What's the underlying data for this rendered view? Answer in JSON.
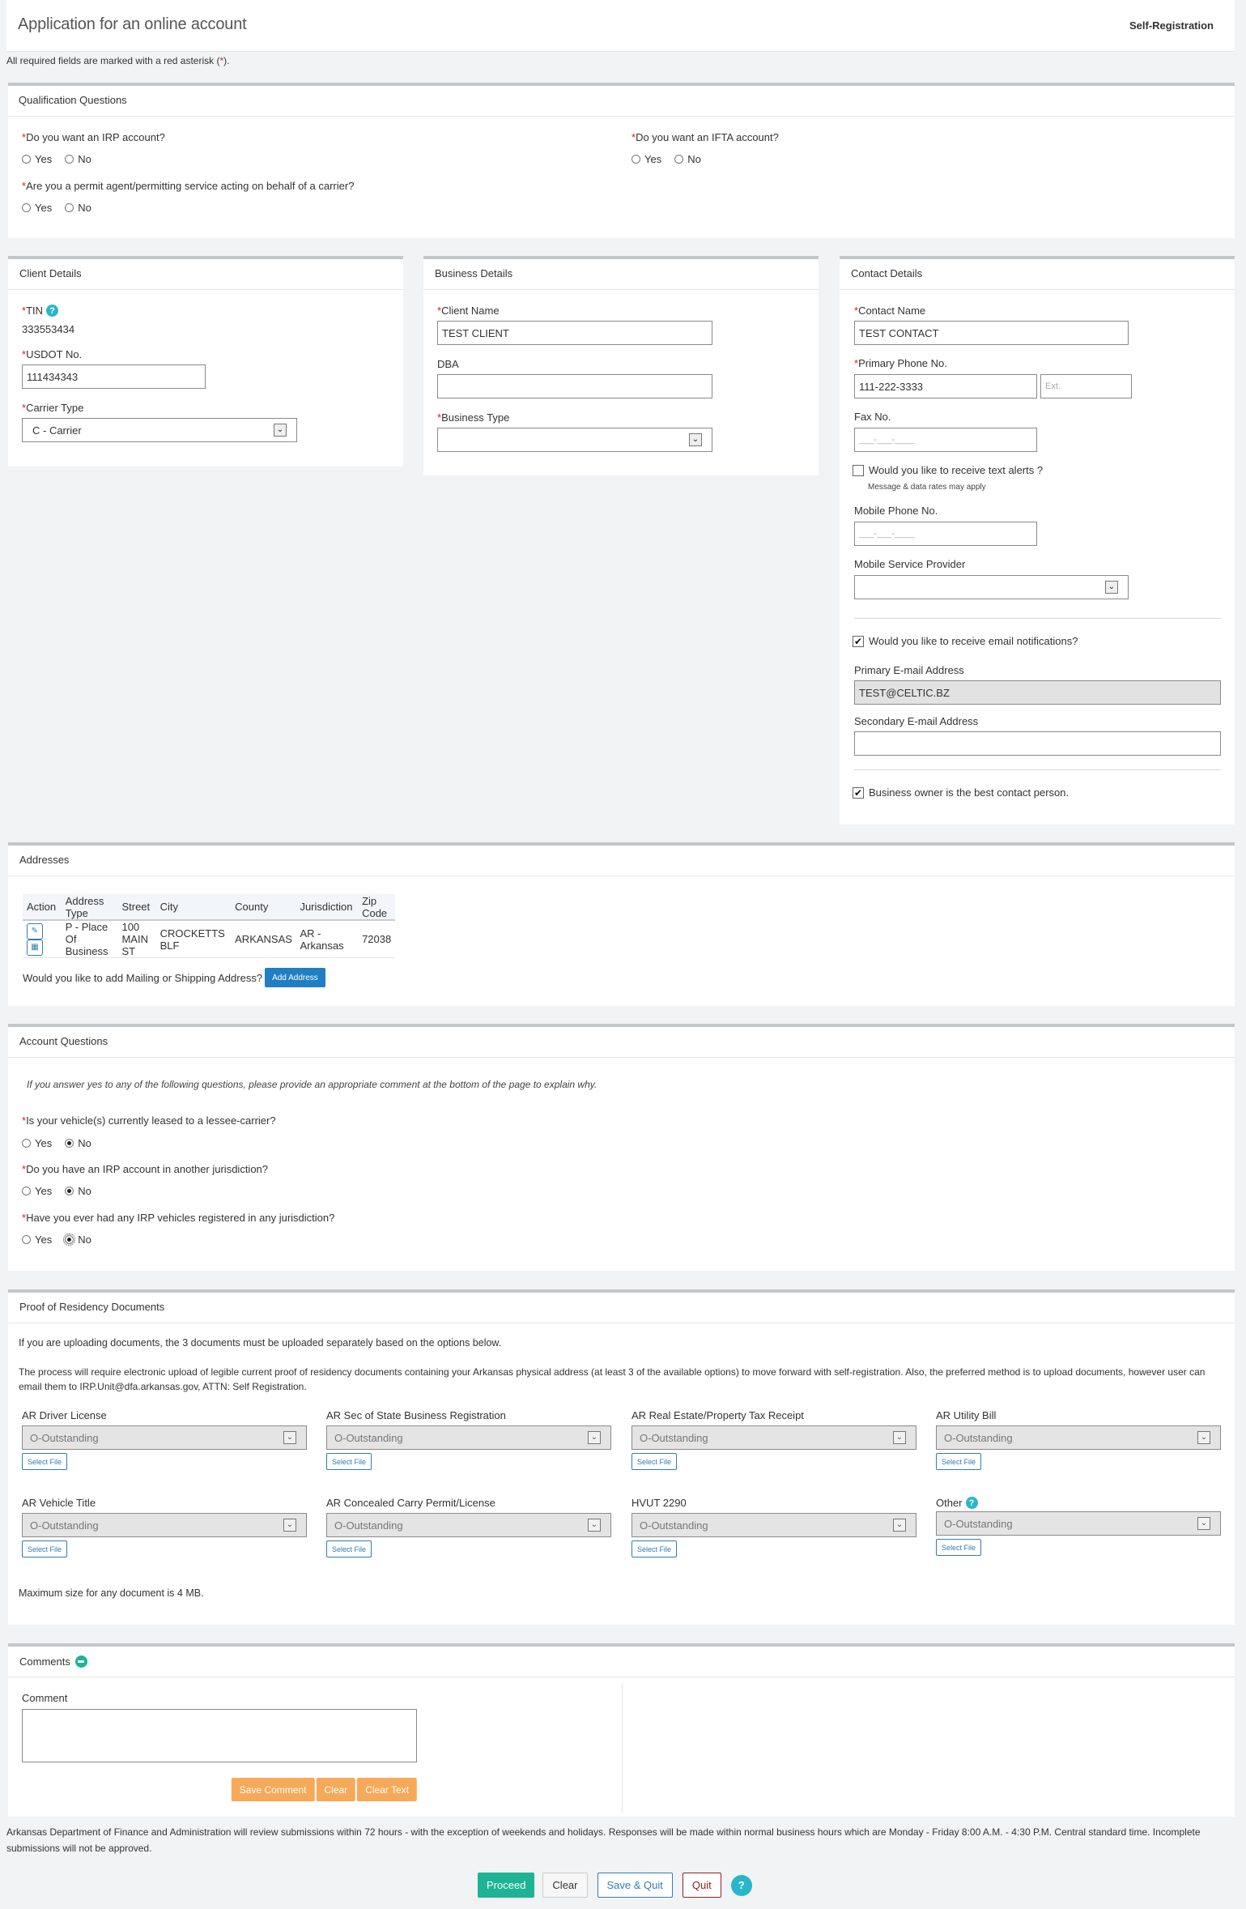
{
  "header": {
    "title": "Application for an online account",
    "context": "Self-Registration",
    "required_note_prefix": "All required fields are marked with a red asterisk (",
    "required_note_star": "*",
    "required_note_suffix": ")."
  },
  "qualification": {
    "title": "Qualification Questions",
    "questions": [
      {
        "label": "Do you want an IRP account?",
        "yes": "Yes",
        "no": "No",
        "selected": null
      },
      {
        "label": "Do you want an IFTA account?",
        "yes": "Yes",
        "no": "No",
        "selected": null
      },
      {
        "label": "Are you a permit agent/permitting service acting on behalf of a carrier?",
        "yes": "Yes",
        "no": "No",
        "selected": null
      }
    ]
  },
  "client": {
    "title": "Client Details",
    "tin_label": "TIN",
    "tin_value": "333553434",
    "usdot_label": "USDOT No.",
    "usdot_value": "111434343",
    "carrier_type_label": "Carrier Type",
    "carrier_type_value": "C - Carrier"
  },
  "business": {
    "title": "Business Details",
    "client_name_label": "Client Name",
    "client_name_value": "TEST CLIENT",
    "dba_label": "DBA",
    "dba_value": "",
    "business_type_label": "Business Type",
    "business_type_value": ""
  },
  "contact": {
    "title": "Contact Details",
    "contact_name_label": "Contact Name",
    "contact_name_value": "TEST CONTACT",
    "primary_phone_label": "Primary Phone No.",
    "primary_phone_value": "111-222-3333",
    "ext_placeholder": "Ext.",
    "fax_label": "Fax No.",
    "fax_mask": "___-___-____",
    "text_alerts_label": "Would you like to receive text alerts ?",
    "text_alerts_checked": false,
    "text_alerts_note": "Message & data rates may apply",
    "mobile_label": "Mobile Phone No.",
    "mobile_mask": "___-___-____",
    "provider_label": "Mobile Service Provider",
    "provider_value": "",
    "email_notif_label": "Would you like to receive email notifications?",
    "email_notif_checked": true,
    "primary_email_label": "Primary E-mail Address",
    "primary_email_value": "TEST@CELTIC.BZ",
    "secondary_email_label": "Secondary E-mail Address",
    "secondary_email_value": "",
    "owner_contact_label": "Business owner is the best contact person.",
    "owner_contact_checked": true
  },
  "addresses": {
    "title": "Addresses",
    "columns": [
      "Action",
      "Address Type",
      "Street",
      "City",
      "County",
      "Jurisdiction",
      "Zip Code"
    ],
    "rows": [
      {
        "type": "P - Place Of Business",
        "street": "100 MAIN ST",
        "city": "CROCKETTS BLF",
        "county": "ARKANSAS",
        "jurisdiction": "AR - Arkansas",
        "zip": "72038"
      }
    ],
    "add_prompt": "Would you like to add Mailing or Shipping Address?",
    "add_button": "Add Address"
  },
  "account_questions": {
    "title": "Account Questions",
    "note": "If you answer yes to any of the following questions, please provide an appropriate comment at the bottom of the page to explain why.",
    "questions": [
      {
        "label": "Is your vehicle(s) currently leased to a lessee-carrier?",
        "yes": "Yes",
        "no": "No",
        "selected": "No"
      },
      {
        "label": "Do you have an IRP account in another jurisdiction?",
        "yes": "Yes",
        "no": "No",
        "selected": "No"
      },
      {
        "label": "Have you ever had any IRP vehicles registered in any jurisdiction?",
        "yes": "Yes",
        "no": "No",
        "selected": "No"
      }
    ]
  },
  "residency": {
    "title": "Proof of Residency Documents",
    "intro_bold": "If you are uploading documents, the 3 documents must be uploaded separately based on the options below.",
    "intro": "The process will require electronic upload of legible current proof of residency documents containing your Arkansas physical address (at least 3 of the available options) to move forward with self-registration. Also, the preferred method is to upload documents, however user can email them to IRP.Unit@dfa.arkansas.gov, ATTN: Self Registration.",
    "select_file_label": "Select File",
    "documents": [
      {
        "label": "AR Driver License",
        "status": "O-Outstanding"
      },
      {
        "label": "AR Sec of State Business Registration",
        "status": "O-Outstanding"
      },
      {
        "label": "AR Real Estate/Property Tax Receipt",
        "status": "O-Outstanding"
      },
      {
        "label": "AR Utility Bill",
        "status": "O-Outstanding"
      },
      {
        "label": "AR Vehicle Title",
        "status": "O-Outstanding"
      },
      {
        "label": "AR Concealed Carry Permit/License",
        "status": "O-Outstanding"
      },
      {
        "label": "HVUT 2290",
        "status": "O-Outstanding"
      },
      {
        "label": "Other",
        "status": "O-Outstanding",
        "help": true
      }
    ],
    "max_size_note": "Maximum size for any document is 4 MB."
  },
  "comments": {
    "title": "Comments",
    "comment_label": "Comment",
    "comment_value": "",
    "save_button": "Save Comment",
    "clear_button": "Clear",
    "clear_text_button": "Clear Text"
  },
  "footer": {
    "note": "Arkansas Department of Finance and Administration will review submissions within 72 hours - with the exception of weekends and holidays. Responses will be made within normal business hours which are Monday - Friday 8:00 A.M. - 4:30 P.M. Central standard time. Incomplete submissions will not be approved.",
    "proceed": "Proceed",
    "clear": "Clear",
    "save_quit": "Save & Quit",
    "quit": "Quit",
    "help": "?"
  },
  "colors": {
    "required": "#d71920",
    "help": "#29b6c9",
    "proceed": "#1db394",
    "primary_blue": "#1f7fc2",
    "orange": "#f7a95a",
    "quit_red": "#8b2323"
  }
}
